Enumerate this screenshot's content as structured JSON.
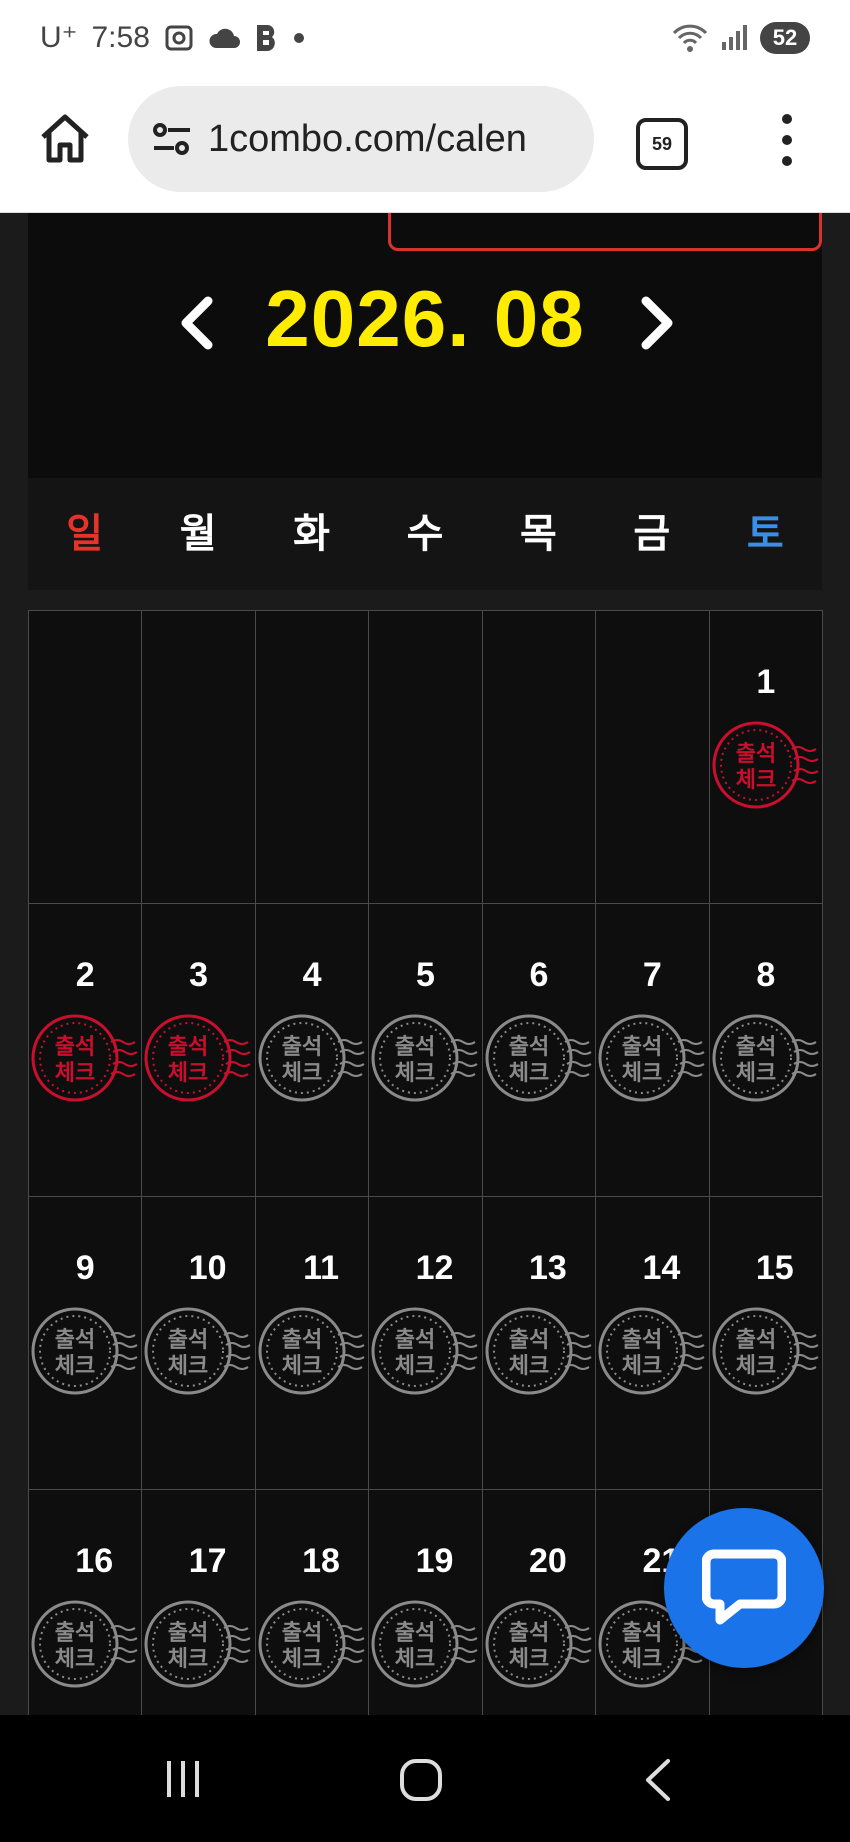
{
  "status_bar": {
    "carrier": "U⁺",
    "time": "7:58",
    "battery": "52"
  },
  "browser": {
    "url": "1combo.com/calen",
    "tab_count": "59"
  },
  "calendar": {
    "month_label": "2026. 08",
    "weekdays": [
      "일",
      "월",
      "화",
      "수",
      "목",
      "금",
      "토"
    ],
    "stamp_text": [
      "출석",
      "체크"
    ],
    "checked_days": [
      1,
      2,
      3
    ],
    "days": [
      "",
      "",
      "",
      "",
      "",
      "",
      "1",
      "2",
      "3",
      "4",
      "5",
      "6",
      "7",
      "8",
      "9",
      "10",
      "11",
      "12",
      "13",
      "14",
      "15",
      "16",
      "17",
      "18",
      "19",
      "20",
      "21",
      ""
    ]
  },
  "colors": {
    "month_title": "#ffec00",
    "sunday": "#e5332a",
    "saturday": "#3a8ee6",
    "stamp_checked": "#c8102e",
    "stamp_unchecked": "#8a8a8a",
    "chat_button": "#1a73e8"
  },
  "icons": {
    "home": "home-icon",
    "site_settings": "tune-icon",
    "tabs": "tabs-icon",
    "menu": "more-vert-icon",
    "prev": "chevron-left-icon",
    "next": "chevron-right-icon",
    "chat": "chat-bubble-icon",
    "nav_recent": "recent-apps-icon",
    "nav_home": "nav-home-icon",
    "nav_back": "nav-back-icon"
  }
}
